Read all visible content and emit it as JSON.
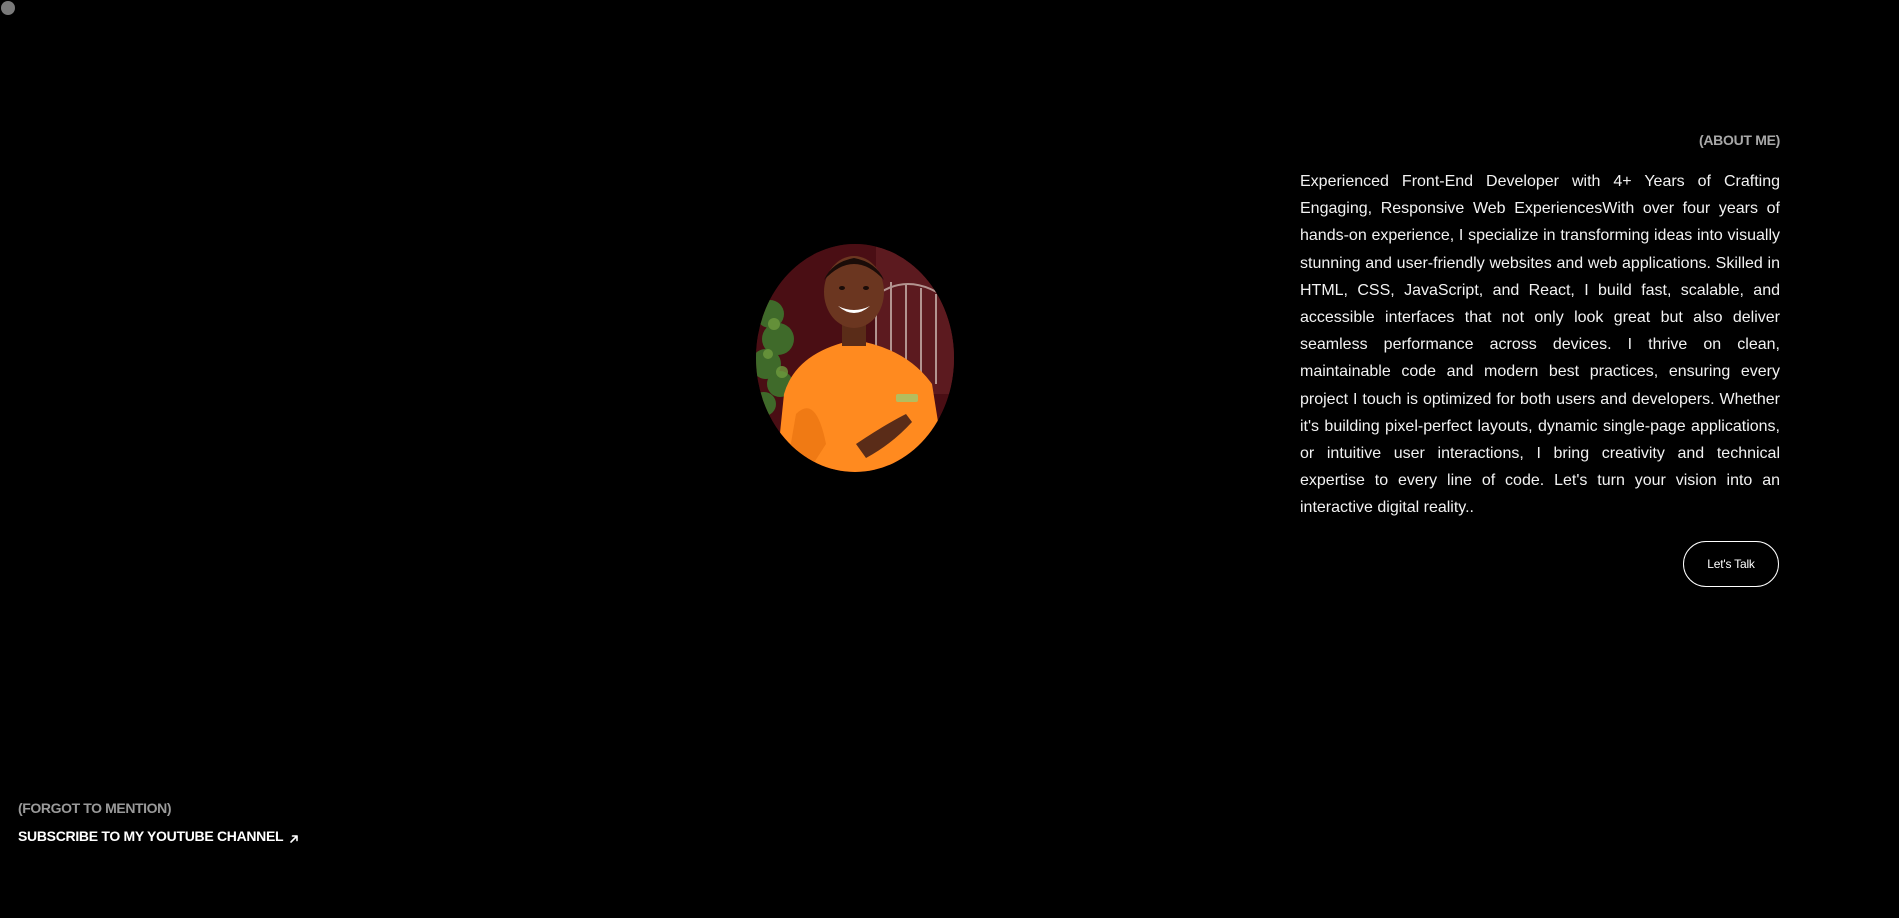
{
  "about": {
    "label": "(ABOUT ME)",
    "bio": "Experienced Front-End Developer with 4+ Years of Crafting Engaging, Responsive Web ExperiencesWith over four years of hands-on experience, I specialize in transforming ideas into visually stunning and user-friendly websites and web applications. Skilled in HTML, CSS, JavaScript, and React, I build fast, scalable, and accessible interfaces that not only look great but also deliver seamless performance across devices. I thrive on clean, maintainable code and modern best practices, ensuring every project I touch is optimized for both users and developers. Whether it's building pixel-perfect layouts, dynamic single-page applications, or intuitive user interactions, I bring creativity and technical expertise to every line of code. Let's turn your vision into an interactive digital reality..",
    "cta_label": "Let's Talk"
  },
  "footer": {
    "forgot_label": "(FORGOT TO MENTION)",
    "youtube_label": "SUBSCRIBE TO MY YOUTUBE CHANNEL",
    "youtube_icon": "arrow-up-right-icon"
  },
  "colors": {
    "background": "#000000",
    "text": "#ffffff",
    "muted_text": "#a8a8a8",
    "shirt_orange": "#ff8a1f"
  }
}
